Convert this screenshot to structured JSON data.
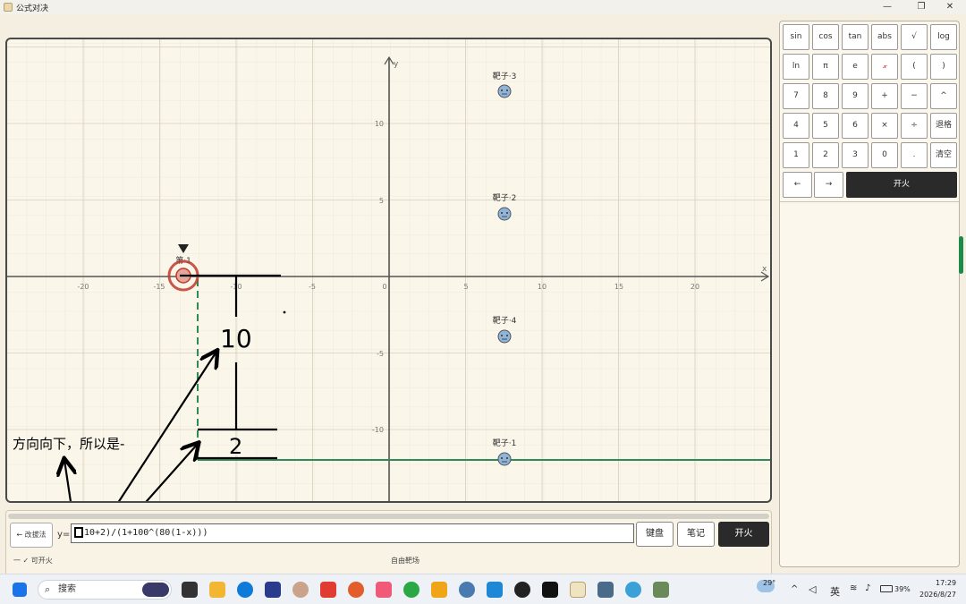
{
  "window": {
    "title": "公式对决",
    "controls": [
      "—",
      "❐",
      "✕"
    ]
  },
  "graph": {
    "x_axis_label": "x",
    "y_axis_label": "y",
    "x_ticks": [
      "-20",
      "-15",
      "-10",
      "-5",
      "0",
      "5",
      "10",
      "15",
      "20"
    ],
    "y_ticks": [
      "10",
      "5",
      "-5",
      "-10"
    ],
    "targets": [
      {
        "label": "靶子·3"
      },
      {
        "label": "靶子·2"
      },
      {
        "label": "靶子·4"
      },
      {
        "label": "靶子·1"
      }
    ],
    "player_label": "第·1",
    "annotations": {
      "ten": "10",
      "two": "2",
      "note": "方向向下，所以是-"
    }
  },
  "bottom": {
    "mode_button": "← 改拔法",
    "y_prefix": "y=",
    "formula_value": "10+2)/(1+100^(80(1-x)))",
    "keyboard_button": "键盘",
    "notes_button": "笔记",
    "fire_button": "开火",
    "status": "一 ✓ 可开火",
    "mode_name": "自由靶场"
  },
  "keypad": {
    "rows": [
      [
        "sin",
        "cos",
        "tan",
        "abs",
        "√",
        "log"
      ],
      [
        "ln",
        "π",
        "e",
        "𝓍",
        "(",
        ")"
      ],
      [
        "7",
        "8",
        "9",
        "+",
        "−",
        "^"
      ],
      [
        "4",
        "5",
        "6",
        "×",
        "÷",
        "退格"
      ],
      [
        "1",
        "2",
        "3",
        "0",
        ".",
        "清空"
      ]
    ],
    "left_arrow": "←",
    "right_arrow": "→",
    "fire": "开火"
  },
  "taskbar": {
    "search_placeholder": "搜索",
    "weather": "29°",
    "ime": "英",
    "battery": "39%",
    "time": "17:29",
    "date": "2026/8/27"
  },
  "colors": {
    "accent_green": "#2e8b57",
    "target_blue": "#8fb4d8",
    "player_red": "#c0392b"
  }
}
